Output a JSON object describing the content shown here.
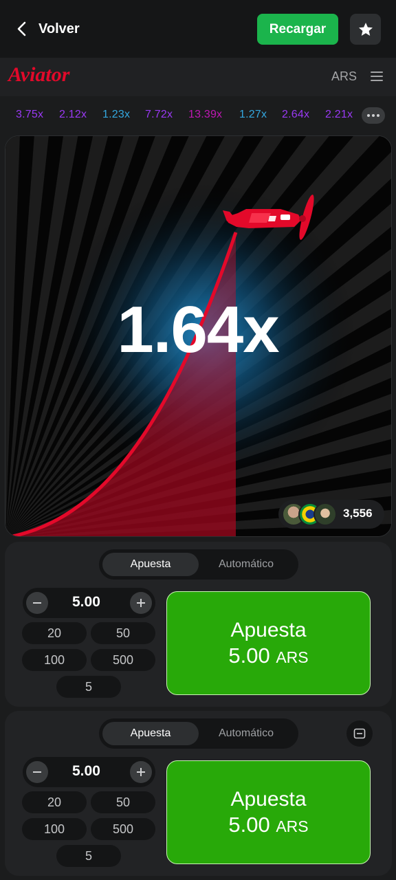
{
  "topbar": {
    "back_label": "Volver",
    "recargar_label": "Recargar"
  },
  "header": {
    "logo": "Aviator",
    "currency": "ARS"
  },
  "history": [
    {
      "value": "3.75x",
      "color": "#9a39f4"
    },
    {
      "value": "2.12x",
      "color": "#9a39f4"
    },
    {
      "value": "1.23x",
      "color": "#34a8e0"
    },
    {
      "value": "7.72x",
      "color": "#9a39f4"
    },
    {
      "value": "13.39x",
      "color": "#c017b4"
    },
    {
      "value": "1.27x",
      "color": "#34a8e0"
    },
    {
      "value": "2.64x",
      "color": "#9a39f4"
    },
    {
      "value": "2.21x",
      "color": "#9a39f4"
    }
  ],
  "game": {
    "multiplier": "1.64x",
    "players_count": "3,556"
  },
  "bet_panels": [
    {
      "tab_active": "Apuesta",
      "tab_other": "Automático",
      "amount": "5.00",
      "quick": [
        "20",
        "50",
        "100",
        "500",
        "5"
      ],
      "bet_title": "Apuesta",
      "bet_amount": "5.00",
      "bet_currency": "ARS"
    },
    {
      "tab_active": "Apuesta",
      "tab_other": "Automático",
      "amount": "5.00",
      "quick": [
        "20",
        "50",
        "100",
        "500",
        "5"
      ],
      "bet_title": "Apuesta",
      "bet_amount": "5.00",
      "bet_currency": "ARS"
    }
  ],
  "colors": {
    "accent_green": "#1bb44c",
    "bet_green": "#28a909",
    "brand_red": "#e3092a"
  }
}
